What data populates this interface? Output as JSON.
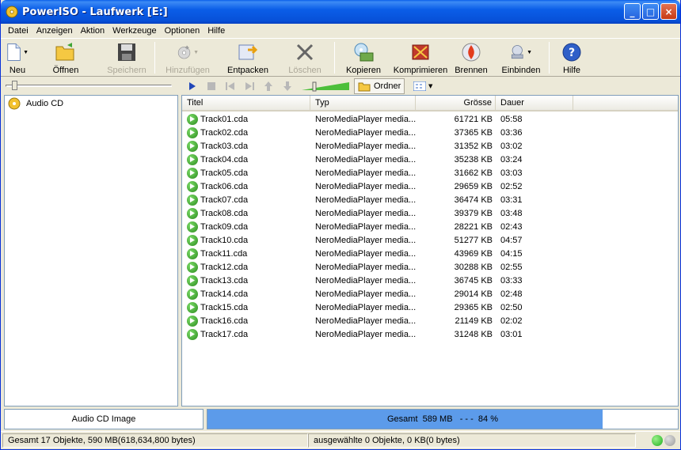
{
  "window": {
    "title": "PowerISO - Laufwerk [E:]",
    "buttons": [
      "_",
      "□",
      "×"
    ]
  },
  "menu": [
    "Datei",
    "Anzeigen",
    "Aktion",
    "Werkzeuge",
    "Optionen",
    "Hilfe"
  ],
  "toolbar": {
    "new": "Neu",
    "open": "Öffnen",
    "save": "Speichern",
    "add": "Hinzufügen",
    "extract": "Entpacken",
    "delete": "Löschen",
    "copy": "Kopieren",
    "compress": "Komprimieren",
    "burn": "Brennen",
    "mount": "Einbinden",
    "help": "Hilfe"
  },
  "subtoolbar": {
    "folder_label": "Ordner"
  },
  "tree": {
    "root_label": "Audio CD"
  },
  "columns": {
    "title": "Titel",
    "type": "Typ",
    "size": "Grösse",
    "duration": "Dauer"
  },
  "files": [
    {
      "name": "Track01.cda",
      "type": "NeroMediaPlayer media...",
      "size": "61721 KB",
      "duration": "05:58"
    },
    {
      "name": "Track02.cda",
      "type": "NeroMediaPlayer media...",
      "size": "37365 KB",
      "duration": "03:36"
    },
    {
      "name": "Track03.cda",
      "type": "NeroMediaPlayer media...",
      "size": "31352 KB",
      "duration": "03:02"
    },
    {
      "name": "Track04.cda",
      "type": "NeroMediaPlayer media...",
      "size": "35238 KB",
      "duration": "03:24"
    },
    {
      "name": "Track05.cda",
      "type": "NeroMediaPlayer media...",
      "size": "31662 KB",
      "duration": "03:03"
    },
    {
      "name": "Track06.cda",
      "type": "NeroMediaPlayer media...",
      "size": "29659 KB",
      "duration": "02:52"
    },
    {
      "name": "Track07.cda",
      "type": "NeroMediaPlayer media...",
      "size": "36474 KB",
      "duration": "03:31"
    },
    {
      "name": "Track08.cda",
      "type": "NeroMediaPlayer media...",
      "size": "39379 KB",
      "duration": "03:48"
    },
    {
      "name": "Track09.cda",
      "type": "NeroMediaPlayer media...",
      "size": "28221 KB",
      "duration": "02:43"
    },
    {
      "name": "Track10.cda",
      "type": "NeroMediaPlayer media...",
      "size": "51277 KB",
      "duration": "04:57"
    },
    {
      "name": "Track11.cda",
      "type": "NeroMediaPlayer media...",
      "size": "43969 KB",
      "duration": "04:15"
    },
    {
      "name": "Track12.cda",
      "type": "NeroMediaPlayer media...",
      "size": "30288 KB",
      "duration": "02:55"
    },
    {
      "name": "Track13.cda",
      "type": "NeroMediaPlayer media...",
      "size": "36745 KB",
      "duration": "03:33"
    },
    {
      "name": "Track14.cda",
      "type": "NeroMediaPlayer media...",
      "size": "29014 KB",
      "duration": "02:48"
    },
    {
      "name": "Track15.cda",
      "type": "NeroMediaPlayer media...",
      "size": "29365 KB",
      "duration": "02:50"
    },
    {
      "name": "Track16.cda",
      "type": "NeroMediaPlayer media...",
      "size": "21149 KB",
      "duration": "02:02"
    },
    {
      "name": "Track17.cda",
      "type": "NeroMediaPlayer media...",
      "size": "31248 KB",
      "duration": "03:01"
    }
  ],
  "status": {
    "image_type": "Audio CD Image",
    "progress_text": "Gesamt  589 MB   - - -  84 %",
    "progress_fraction": 0.84,
    "total": "Gesamt  17 Objekte, 590 MB(618,634,800 bytes)",
    "selected": "ausgewählte 0 Objekte, 0 KB(0 bytes)"
  },
  "colors": {
    "titlebar": "#0A5FEA",
    "progress_fill": "#5C9BEA",
    "play_green": "#2A8A1C",
    "led_green": "#1FB01F",
    "led_gray": "#9A9A9A"
  }
}
